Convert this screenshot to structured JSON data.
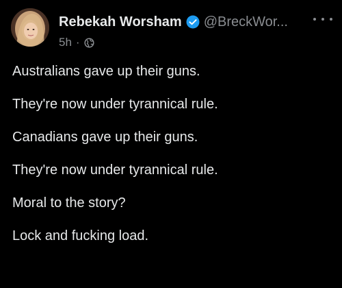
{
  "colors": {
    "background": "#000000",
    "text": "#e7e9ea",
    "muted": "#8a8d91",
    "verified": "#1d9bf0"
  },
  "post": {
    "author": {
      "display_name": "Rebekah Worsham",
      "handle": "@BreckWor...",
      "verified": true,
      "verified_icon": "verified-badge-icon",
      "avatar_icon": "avatar-photo"
    },
    "timestamp": "5h",
    "separator": "·",
    "audience_icon": "globe-icon",
    "more_icon": "more-options-icon",
    "lines": [
      "Australians gave up their guns.",
      "They're now under tyrannical rule.",
      "Canadians gave up their guns.",
      "They're now under tyrannical rule.",
      "Moral to the story?",
      "Lock and fucking load."
    ]
  }
}
